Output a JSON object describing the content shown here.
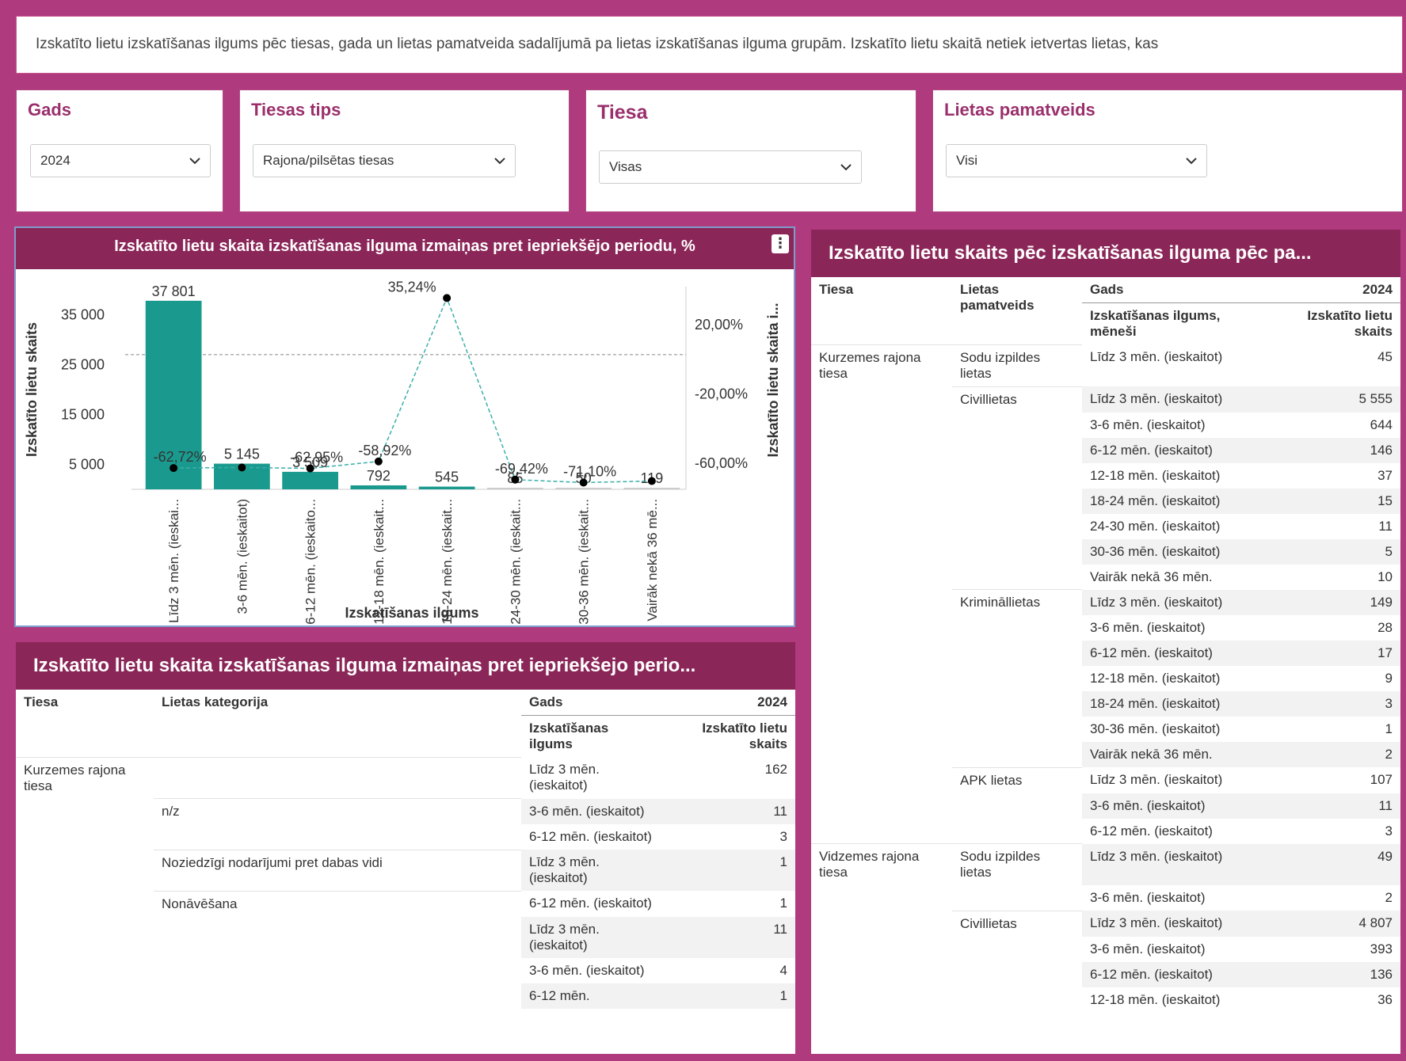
{
  "description": "Izskatīto lietu izskatīšanas ilgums pēc tiesas, gada un lietas pamatveida sadalījumā pa lietas izskatīšanas ilguma grupām. Izskatīto lietu skaitā netiek ietvertas lietas, kas",
  "filters": {
    "year": {
      "label": "Gads",
      "value": "2024"
    },
    "court_type": {
      "label": "Tiesas tips",
      "value": "Rajona/pilsētas tiesas"
    },
    "court": {
      "label": "Tiesa",
      "value": "Visas"
    },
    "case_type": {
      "label": "Lietas pamatveids",
      "value": "Visi"
    }
  },
  "chart": {
    "title": "Izskatīto lietu skaita izskatīšanas ilguma izmaiņas pret iepriekšējo periodu, %",
    "menu_icon": "more-vertical-icon"
  },
  "chart_data": {
    "type": "bar",
    "title": "Izskatīto lietu skaita izskatīšanas ilguma izmaiņas pret iepriekšējo periodu, %",
    "xlabel": "Izskatīšanas ilgums",
    "ylabel": "Izskatīto lietu skaits",
    "y2label": "Izskatīto lietu skaita i...",
    "categories": [
      "Līdz 3 mēn. (ieskai...",
      "3-6 mēn. (ieskaitot)",
      "6-12 mēn. (ieskaito...",
      "12-18 mēn. (ieskait...",
      "18-24 mēn. (ieskait...",
      "24-30 mēn. (ieskait...",
      "30-36 mēn. (ieskait...",
      "Vairāk nekā 36 mē..."
    ],
    "series": [
      {
        "values": [
          37801,
          5145,
          3509,
          792,
          545,
          85,
          50,
          119
        ],
        "labels": [
          "37 801",
          "5 145",
          "3 509",
          "792",
          "545",
          "85",
          "50",
          "119"
        ],
        "color": "#1a9a8e"
      },
      {
        "values": [
          -62.72,
          -62.4,
          -62.95,
          -58.92,
          35.24,
          -69.42,
          -71.1,
          -70.2
        ],
        "labels": [
          "-62,72%",
          "",
          "-62,95%",
          "-58,92%",
          "35,24%",
          "-69,42%",
          "-71,10%",
          ""
        ],
        "color": "#3aaea8"
      }
    ],
    "yticks": [
      "35 000",
      "25 000",
      "15 000",
      "5 000"
    ],
    "ytick_values": [
      35000,
      25000,
      15000,
      5000
    ],
    "y2ticks": [
      "20,00%",
      "-20,00%",
      "-60,00%"
    ],
    "y2tick_values": [
      20,
      -20,
      -60
    ],
    "ylim": [
      0,
      40000
    ],
    "y2lim": [
      -75,
      40
    ]
  },
  "right_table": {
    "title": "Izskatīto lietu skaits pēc izskatīšanas ilguma pēc pa...",
    "headers": {
      "court": "Tiesa",
      "type": "Lietas pamatveids",
      "year_label": "Gads",
      "year": "2024",
      "duration": "Izskatīšanas ilgums, mēneši",
      "count": "Izskatīto lietu skaits"
    },
    "rows": [
      {
        "court": "Kurzemes rajona tiesa",
        "type": "Sodu izpildes lietas",
        "duration": "Līdz 3 mēn. (ieskaitot)",
        "count": "45"
      },
      {
        "court": "",
        "type": "Civillietas",
        "duration": "Līdz 3 mēn. (ieskaitot)",
        "count": "5 555"
      },
      {
        "court": "",
        "type": "",
        "duration": "3-6 mēn. (ieskaitot)",
        "count": "644"
      },
      {
        "court": "",
        "type": "",
        "duration": "6-12 mēn. (ieskaitot)",
        "count": "146"
      },
      {
        "court": "",
        "type": "",
        "duration": "12-18 mēn. (ieskaitot)",
        "count": "37"
      },
      {
        "court": "",
        "type": "",
        "duration": "18-24 mēn. (ieskaitot)",
        "count": "15"
      },
      {
        "court": "",
        "type": "",
        "duration": "24-30 mēn. (ieskaitot)",
        "count": "11"
      },
      {
        "court": "",
        "type": "",
        "duration": "30-36 mēn. (ieskaitot)",
        "count": "5"
      },
      {
        "court": "",
        "type": "",
        "duration": "Vairāk nekā 36 mēn.",
        "count": "10"
      },
      {
        "court": "",
        "type": "Krimināllietas",
        "duration": "Līdz 3 mēn. (ieskaitot)",
        "count": "149"
      },
      {
        "court": "",
        "type": "",
        "duration": "3-6 mēn. (ieskaitot)",
        "count": "28"
      },
      {
        "court": "",
        "type": "",
        "duration": "6-12 mēn. (ieskaitot)",
        "count": "17"
      },
      {
        "court": "",
        "type": "",
        "duration": "12-18 mēn. (ieskaitot)",
        "count": "9"
      },
      {
        "court": "",
        "type": "",
        "duration": "18-24 mēn. (ieskaitot)",
        "count": "3"
      },
      {
        "court": "",
        "type": "",
        "duration": "30-36 mēn. (ieskaitot)",
        "count": "1"
      },
      {
        "court": "",
        "type": "",
        "duration": "Vairāk nekā 36 mēn.",
        "count": "2"
      },
      {
        "court": "",
        "type": "APK lietas",
        "duration": "Līdz 3 mēn. (ieskaitot)",
        "count": "107"
      },
      {
        "court": "",
        "type": "",
        "duration": "3-6 mēn. (ieskaitot)",
        "count": "11"
      },
      {
        "court": "",
        "type": "",
        "duration": "6-12 mēn. (ieskaitot)",
        "count": "3"
      },
      {
        "court": "Vidzemes rajona tiesa",
        "type": "Sodu izpildes lietas",
        "duration": "Līdz 3 mēn. (ieskaitot)",
        "count": "49"
      },
      {
        "court": "",
        "type": "",
        "duration": "3-6 mēn. (ieskaitot)",
        "count": "2"
      },
      {
        "court": "",
        "type": "Civillietas",
        "duration": "Līdz 3 mēn. (ieskaitot)",
        "count": "4 807"
      },
      {
        "court": "",
        "type": "",
        "duration": "3-6 mēn. (ieskaitot)",
        "count": "393"
      },
      {
        "court": "",
        "type": "",
        "duration": "6-12 mēn. (ieskaitot)",
        "count": "136"
      },
      {
        "court": "",
        "type": "",
        "duration": "12-18 mēn. (ieskaitot)",
        "count": "36"
      }
    ]
  },
  "bottom_table": {
    "title": "Izskatīto lietu skaita izskatīšanas ilguma izmaiņas pret iepriekšejo perio...",
    "headers": {
      "court": "Tiesa",
      "category": "Lietas kategorija",
      "year_label": "Gads",
      "year": "2024",
      "duration": "Izskatīšanas ilgums",
      "count": "Izskatīto lietu skaits"
    },
    "rows": [
      {
        "court": "Kurzemes rajona tiesa",
        "category": "",
        "duration": "Līdz 3 mēn. (ieskaitot)",
        "count": "162"
      },
      {
        "court": "",
        "category": "n/z",
        "duration": "3-6 mēn. (ieskaitot)",
        "count": "11"
      },
      {
        "court": "",
        "category": "",
        "duration": "6-12 mēn. (ieskaitot)",
        "count": "3"
      },
      {
        "court": "",
        "category": "Noziedzīgi nodarījumi pret dabas vidi",
        "duration": "Līdz 3 mēn. (ieskaitot)",
        "count": "1"
      },
      {
        "court": "",
        "category": "Nonāvēšana",
        "duration": "6-12 mēn. (ieskaitot)",
        "count": "1"
      },
      {
        "court": "",
        "category": "",
        "duration": "Līdz 3 mēn. (ieskaitot)",
        "count": "11"
      },
      {
        "court": "",
        "category": "",
        "duration": "3-6 mēn. (ieskaitot)",
        "count": "4"
      },
      {
        "court": "",
        "category": "",
        "duration": "6-12 mēn.",
        "count": "1"
      }
    ]
  }
}
